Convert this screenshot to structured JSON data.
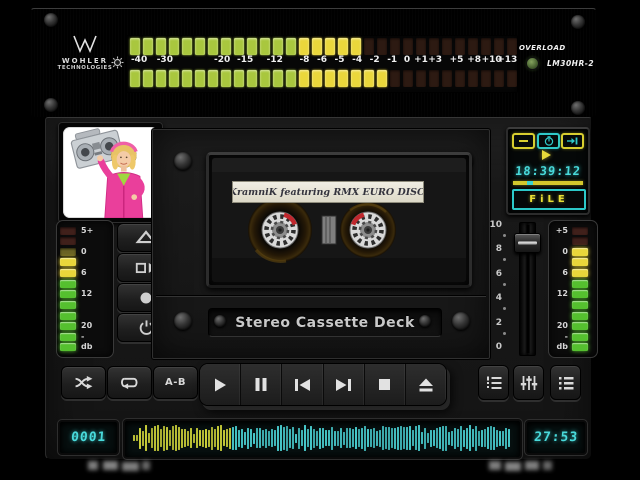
{
  "meter_bridge": {
    "brand_line1": "WOHLER",
    "brand_line2": "TECHNOLOGIES",
    "overload_label": "OVERLOAD",
    "model": "LM30HR-2",
    "scale": [
      {
        "t": "-40",
        "p": 3.1
      },
      {
        "t": "-30",
        "p": 9.7
      },
      {
        "t": "-20",
        "p": 24.4
      },
      {
        "t": "-15",
        "p": 30.3
      },
      {
        "t": "-12",
        "p": 37.9
      },
      {
        "t": "-8",
        "p": 45.5
      },
      {
        "t": "-6",
        "p": 50.0
      },
      {
        "t": "-5",
        "p": 54.5
      },
      {
        "t": "-4",
        "p": 59.0
      },
      {
        "t": "-2",
        "p": 63.5
      },
      {
        "t": "-1",
        "p": 68.0
      },
      {
        "t": "0",
        "p": 71.8
      },
      {
        "t": "+1",
        "p": 75.4
      },
      {
        "t": "+3",
        "p": 79.0
      },
      {
        "t": "+5",
        "p": 84.5
      },
      {
        "t": "+8",
        "p": 89.0
      },
      {
        "t": "+10",
        "p": 93.5
      },
      {
        "t": "+13",
        "p": 97.5
      }
    ],
    "segments": {
      "total": 30,
      "green_count": 13,
      "rows": [
        {
          "lit": 18
        },
        {
          "lit": 20
        }
      ]
    },
    "colors": {
      "green": "#a9c73e",
      "yellow": "#ead73b",
      "off": "#2d1a12"
    }
  },
  "led_colors": {
    "off-red": "#40201b",
    "dim-yellow": "#6a6324",
    "yellow": "#e9d63b",
    "green": "#55c02f"
  },
  "left_meter": {
    "label_side": "right",
    "leds": [
      "off-red",
      "off-red",
      "dim-yellow",
      "yellow",
      "yellow",
      "green",
      "green",
      "green",
      "green",
      "green",
      "green",
      "green"
    ],
    "labels": [
      {
        "row": 0,
        "text": "5+"
      },
      {
        "row": 2,
        "text": "0"
      },
      {
        "row": 4,
        "text": "6"
      },
      {
        "row": 6,
        "text": "12"
      },
      {
        "row": 9,
        "text": "20"
      },
      {
        "row": 10,
        "text": "-"
      },
      {
        "row": 11,
        "text": "db"
      }
    ]
  },
  "right_meter": {
    "label_side": "left",
    "leds": [
      "off-red",
      "off-red",
      "yellow",
      "yellow",
      "yellow",
      "green",
      "green",
      "green",
      "green",
      "green",
      "green",
      "green"
    ],
    "labels": [
      {
        "row": 0,
        "text": "+5"
      },
      {
        "row": 2,
        "text": "0"
      },
      {
        "row": 4,
        "text": "6"
      },
      {
        "row": 6,
        "text": "12"
      },
      {
        "row": 9,
        "text": "20"
      },
      {
        "row": 10,
        "text": "-"
      },
      {
        "row": 11,
        "text": "db"
      }
    ]
  },
  "pitch_fader": {
    "scale": [
      "10",
      "8",
      "6",
      "4",
      "2",
      "0"
    ],
    "position_pct": 10
  },
  "deck": {
    "cassette_label": "Dj KramniK featuring RMX EURO DISCO...",
    "plate_label": "Stereo Cassette Deck"
  },
  "clock_panel": {
    "time": "18:39:12",
    "file_label": "FiLE",
    "progress_pct": 20
  },
  "transport": {
    "ab_label": "A-B"
  },
  "bottom_bar": {
    "counter": "0001",
    "time": "27:53",
    "waveform": {
      "progress": 0.26,
      "played": "#ccd13a",
      "remaining": "#47c7c9",
      "bars": 126
    }
  }
}
